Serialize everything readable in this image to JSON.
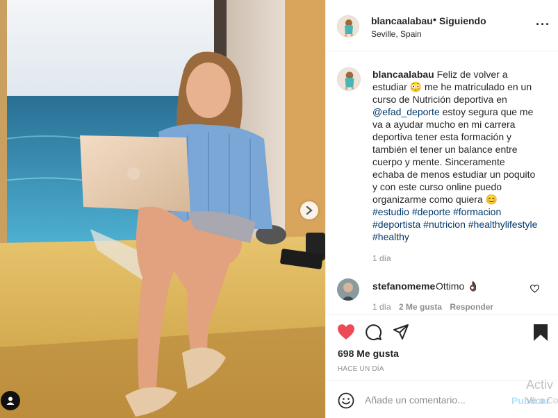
{
  "post": {
    "username": "blancaalabau",
    "follow_dot": "•",
    "follow_status": "Siguiendo",
    "location": "Seville, Spain",
    "more_icon": "more-horizontal-icon"
  },
  "caption": {
    "username": "blancaalabau",
    "text_1": "Feliz de volver a estudiar",
    "emoji_1": "😳",
    "text_2": "me he matriculado en un curso de Nutrición deportiva en",
    "mention": "@efad_deporte",
    "text_3": "estoy segura que me va a ayudar mucho en mi carrera deportiva tener esta formación y también el tener un balance entre cuerpo y mente. Sinceramente echaba de menos estudiar un poquito y con este curso online puedo organizarme como quiera",
    "emoji_2": "😊",
    "hashtags": [
      "#estudio",
      "#deporte",
      "#formacion",
      "#deportista",
      "#nutricion",
      "#healthylifestyle",
      "#healthy"
    ],
    "time": "1 día"
  },
  "comment": {
    "username": "stefanomeme",
    "text": "Ottimo",
    "emoji": "👌🏿",
    "time": "1 día",
    "likes": "2 Me gusta",
    "reply": "Responder"
  },
  "actions": {
    "likes": "698 Me gusta",
    "date": "HACE UN DÍA",
    "like_color": "#ed4956"
  },
  "composer": {
    "placeholder": "Añade un comentario...",
    "publish": "Publicar"
  },
  "watermark": {
    "line1": "Activ",
    "line2": "Ve a Co"
  }
}
